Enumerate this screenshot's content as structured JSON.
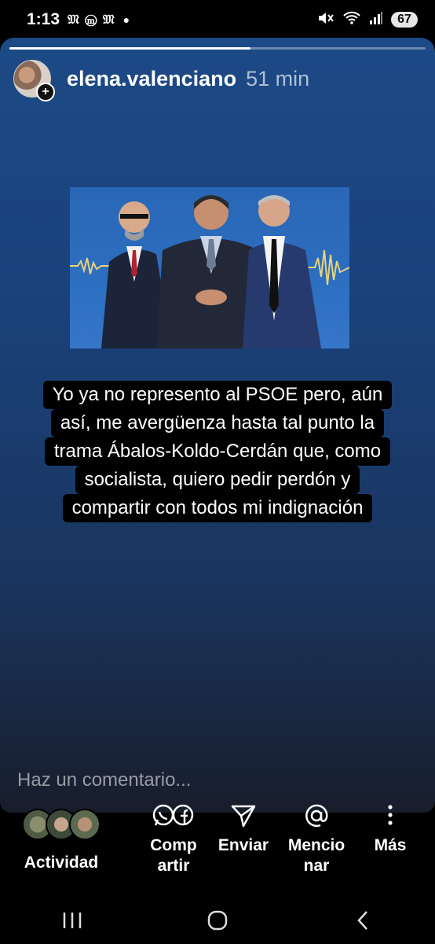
{
  "status_bar": {
    "time": "1:13",
    "notifications": "ᵐ ᴹ ᵐ",
    "notif_text": "♏♏♏",
    "battery": "67"
  },
  "story": {
    "username": "elena.valenciano",
    "time_ago": "51 min",
    "progress": 0.58,
    "caption_lines": [
      "Yo ya no represento al PSOE pero, aún",
      "así, me avergüenza hasta tal punto la",
      "trama Ábalos-Koldo-Cerdán que, como",
      "socialista, quiero pedir perdón y",
      "compartir con todos mi indignación"
    ],
    "comment_placeholder": "Haz un comentario..."
  },
  "actions": {
    "activity": "Actividad",
    "share_line1": "Comp",
    "share_line2": "artir",
    "send": "Enviar",
    "mention_line1": "Mencio",
    "mention_line2": "nar",
    "more": "Más"
  },
  "colors": {
    "story_top": "#1c4a86",
    "story_bottom": "#181d2b",
    "photo_bg": "#2d6fc0"
  }
}
